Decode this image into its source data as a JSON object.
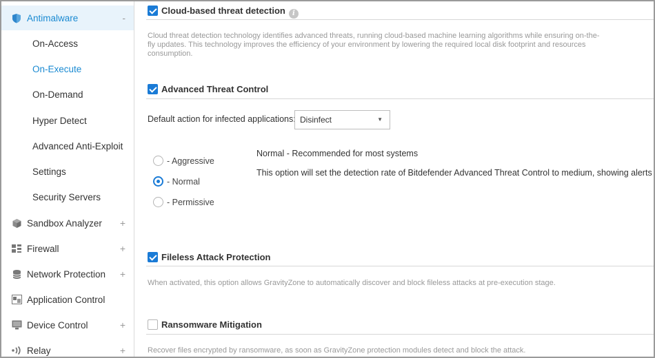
{
  "sidebar": {
    "items": [
      {
        "label": "Antimalware",
        "icon": "shield-icon",
        "expander": "-"
      },
      {
        "label": "On-Access"
      },
      {
        "label": "On-Execute"
      },
      {
        "label": "On-Demand"
      },
      {
        "label": "Hyper Detect"
      },
      {
        "label": "Advanced Anti-Exploit"
      },
      {
        "label": "Settings"
      },
      {
        "label": "Security Servers"
      },
      {
        "label": "Sandbox Analyzer",
        "icon": "cube-icon",
        "expander": "+"
      },
      {
        "label": "Firewall",
        "icon": "firewall-icon",
        "expander": "+"
      },
      {
        "label": "Network Protection",
        "icon": "database-icon",
        "expander": "+"
      },
      {
        "label": "Application Control",
        "icon": "application-icon"
      },
      {
        "label": "Device Control",
        "icon": "monitor-icon",
        "expander": "+"
      },
      {
        "label": "Relay",
        "icon": "relay-icon",
        "expander": "+"
      }
    ]
  },
  "main": {
    "cloud": {
      "title": "Cloud-based threat detection",
      "checked": true,
      "info_icon": "i",
      "description": "Cloud threat detection technology identifies advanced threats, running cloud-based machine learning algorithms while ensuring on-the-fly updates. This technology improves the efficiency of your environment by lowering the required local disk footprint and resources consumption."
    },
    "atc": {
      "title": "Advanced Threat Control",
      "checked": true,
      "default_action_label": "Default action for infected applications:",
      "default_action_value": "Disinfect",
      "levels": [
        "- Aggressive",
        "- Normal",
        "- Permissive"
      ],
      "selected_level": "- Normal",
      "level_title": "Normal - Recommended for most systems",
      "level_description": "This option will set the detection rate of Bitdefender Advanced Threat Control to medium, showing alerts that"
    },
    "fileless": {
      "title": "Fileless Attack Protection",
      "checked": true,
      "description": "When activated, this option allows GravityZone to automatically discover and block fileless attacks at pre-execution stage."
    },
    "ransomware": {
      "title": "Ransomware Mitigation",
      "checked": false,
      "description": "Recover files encrypted by ransomware, as soon as GravityZone protection modules detect and block the attack."
    }
  },
  "colors": {
    "accent": "#1a7bd6",
    "active_bg": "#e8f3fb"
  }
}
